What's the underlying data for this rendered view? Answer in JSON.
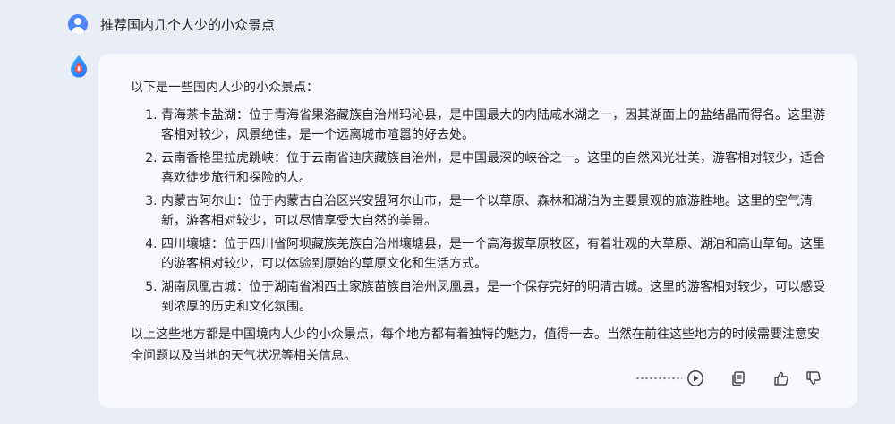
{
  "user": {
    "question": "推荐国内几个人少的小众景点"
  },
  "answer": {
    "intro": "以下是一些国内人少的小众景点：",
    "places": [
      {
        "text": "青海茶卡盐湖：位于青海省果洛藏族自治州玛沁县，是中国最大的内陆咸水湖之一，因其湖面上的盐结晶而得名。这里游客相对较少，风景绝佳，是一个远离城市喧嚣的好去处。"
      },
      {
        "text": "云南香格里拉虎跳峡：位于云南省迪庆藏族自治州，是中国最深的峡谷之一。这里的自然风光壮美，游客相对较少，适合喜欢徒步旅行和探险的人。"
      },
      {
        "text": "内蒙古阿尔山：位于内蒙古自治区兴安盟阿尔山市，是一个以草原、森林和湖泊为主要景观的旅游胜地。这里的空气清新，游客相对较少，可以尽情享受大自然的美景。"
      },
      {
        "text": "四川壤塘：位于四川省阿坝藏族羌族自治州壤塘县，是一个高海拔草原牧区，有着壮观的大草原、湖泊和高山草甸。这里的游客相对较少，可以体验到原始的草原文化和生活方式。"
      },
      {
        "text": "湖南凤凰古城：位于湖南省湘西土家族苗族自治州凤凰县，是一个保存完好的明清古城。这里的游客相对较少，可以感受到浓厚的历史和文化氛围。"
      }
    ],
    "outro": "以上这些地方都是中国境内人少的小众景点，每个地方都有着独特的魅力，值得一去。当然在前往这些地方的时候需要注意安全问题以及当地的天气状况等相关信息。"
  },
  "toolbar": {
    "icons": [
      "play-icon",
      "copy-icon",
      "thumbs-up-icon",
      "thumbs-down-icon"
    ]
  },
  "colors": {
    "background": "#e9edf6",
    "card": "#f6f8fc",
    "accent": "#4f86ff"
  }
}
